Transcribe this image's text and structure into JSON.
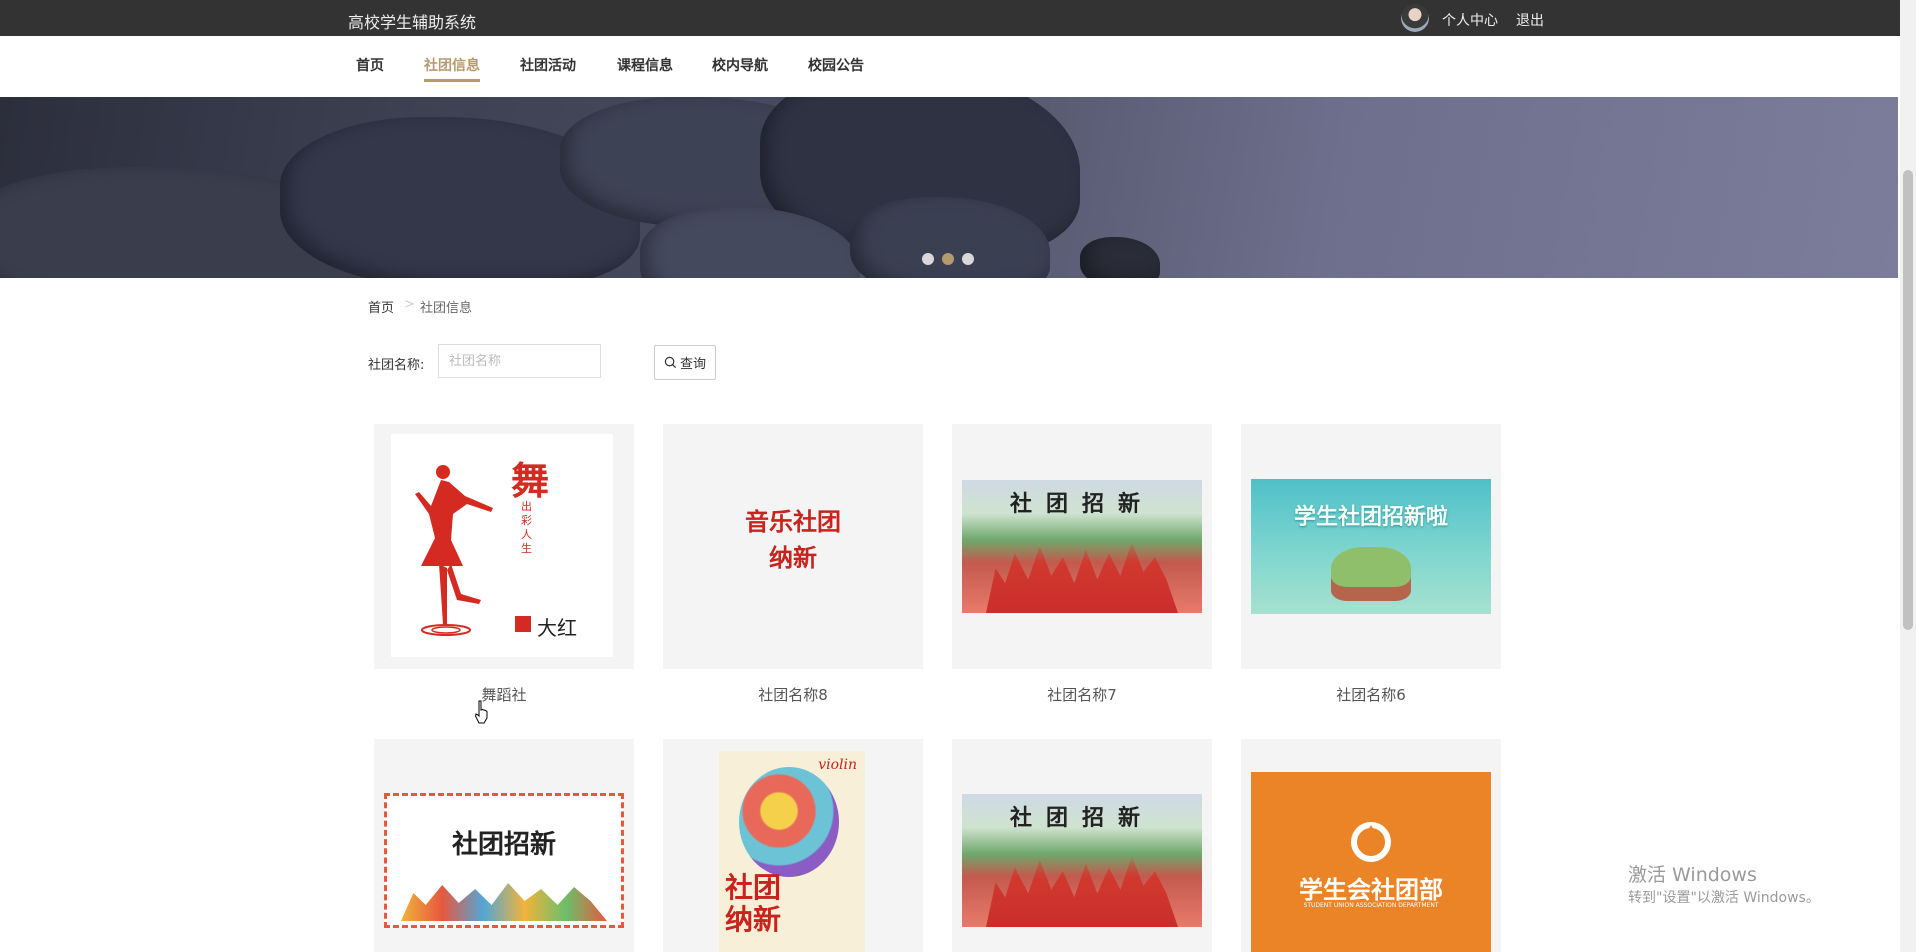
{
  "header": {
    "app_title": "高校学生辅助系统",
    "user_center": "个人中心",
    "logout": "退出"
  },
  "nav": {
    "items": [
      {
        "label": "首页"
      },
      {
        "label": "社团信息",
        "active": true
      },
      {
        "label": "社团活动"
      },
      {
        "label": "课程信息"
      },
      {
        "label": "校内导航"
      },
      {
        "label": "校园公告"
      }
    ]
  },
  "banner": {
    "slide_count": 3,
    "active_index": 1
  },
  "breadcrumb": {
    "home": "首页",
    "separator": ">",
    "current": "社团信息"
  },
  "search": {
    "label": "社团名称:",
    "placeholder": "社团名称",
    "value": "",
    "button": "查询"
  },
  "clubs": [
    {
      "name": "舞蹈社",
      "poster": {
        "title": "舞",
        "subtitle": "出彩人生",
        "tag": "大红"
      }
    },
    {
      "name": "社团名称8",
      "poster": {
        "title": "音乐社团",
        "title2": "纳新"
      }
    },
    {
      "name": "社团名称7",
      "poster": {
        "title": "社团招新"
      }
    },
    {
      "name": "社团名称6",
      "poster": {
        "title": "学生社团招新啦"
      }
    },
    {
      "name": "",
      "poster": {
        "title": "社团招新"
      }
    },
    {
      "name": "",
      "poster": {
        "title": "社团",
        "title2": "纳新",
        "script": "violin"
      }
    },
    {
      "name": "",
      "poster": {
        "title": "社团招新"
      }
    },
    {
      "name": "",
      "poster": {
        "title": "学生会社团部",
        "subtitle": "STUDENT UNION ASSOCIATION DEPARTMENT"
      }
    }
  ],
  "watermark": {
    "line1": "激活 Windows",
    "line2": "转到\"设置\"以激活 Windows。"
  },
  "colors": {
    "accent": "#b59a6e",
    "topbar": "#333333",
    "card_bg": "#f4f4f4"
  }
}
